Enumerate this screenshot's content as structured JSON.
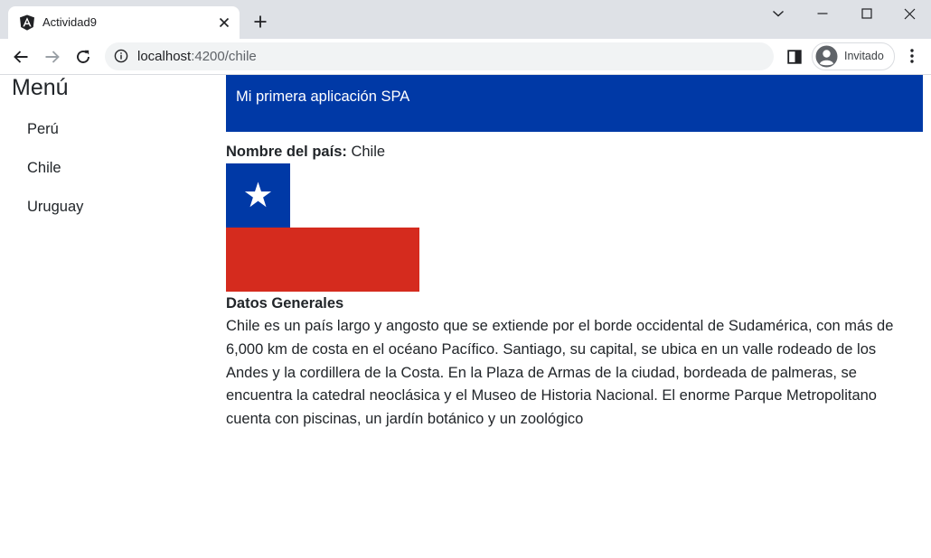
{
  "browser": {
    "tab_title": "Actividad9",
    "url_host": "localhost",
    "url_path": ":4200/chile",
    "profile_label": "Invitado"
  },
  "menu": {
    "title": "Menú",
    "items": [
      {
        "label": "Perú"
      },
      {
        "label": "Chile"
      },
      {
        "label": "Uruguay"
      }
    ]
  },
  "header": {
    "title": "Mi primera aplicación SPA",
    "color": "#0039a6"
  },
  "country": {
    "label": "Nombre del país:",
    "name": "Chile",
    "flag_colors": {
      "blue": "#0039a6",
      "white": "#ffffff",
      "red": "#d52b1e"
    }
  },
  "general": {
    "title": "Datos Generales",
    "text": "Chile es un país largo y angosto que se extiende por el borde occidental de Sudamérica, con más de 6,000 km de costa en el océano Pacífico. Santiago, su capital, se ubica en un valle rodeado de los Andes y la cordillera de la Costa. En la Plaza de Armas de la ciudad, bordeada de palmeras, se encuentra la catedral neoclásica y el Museo de Historia Nacional. El enorme Parque Metropolitano cuenta con piscinas, un jardín botánico y un zoológico"
  }
}
